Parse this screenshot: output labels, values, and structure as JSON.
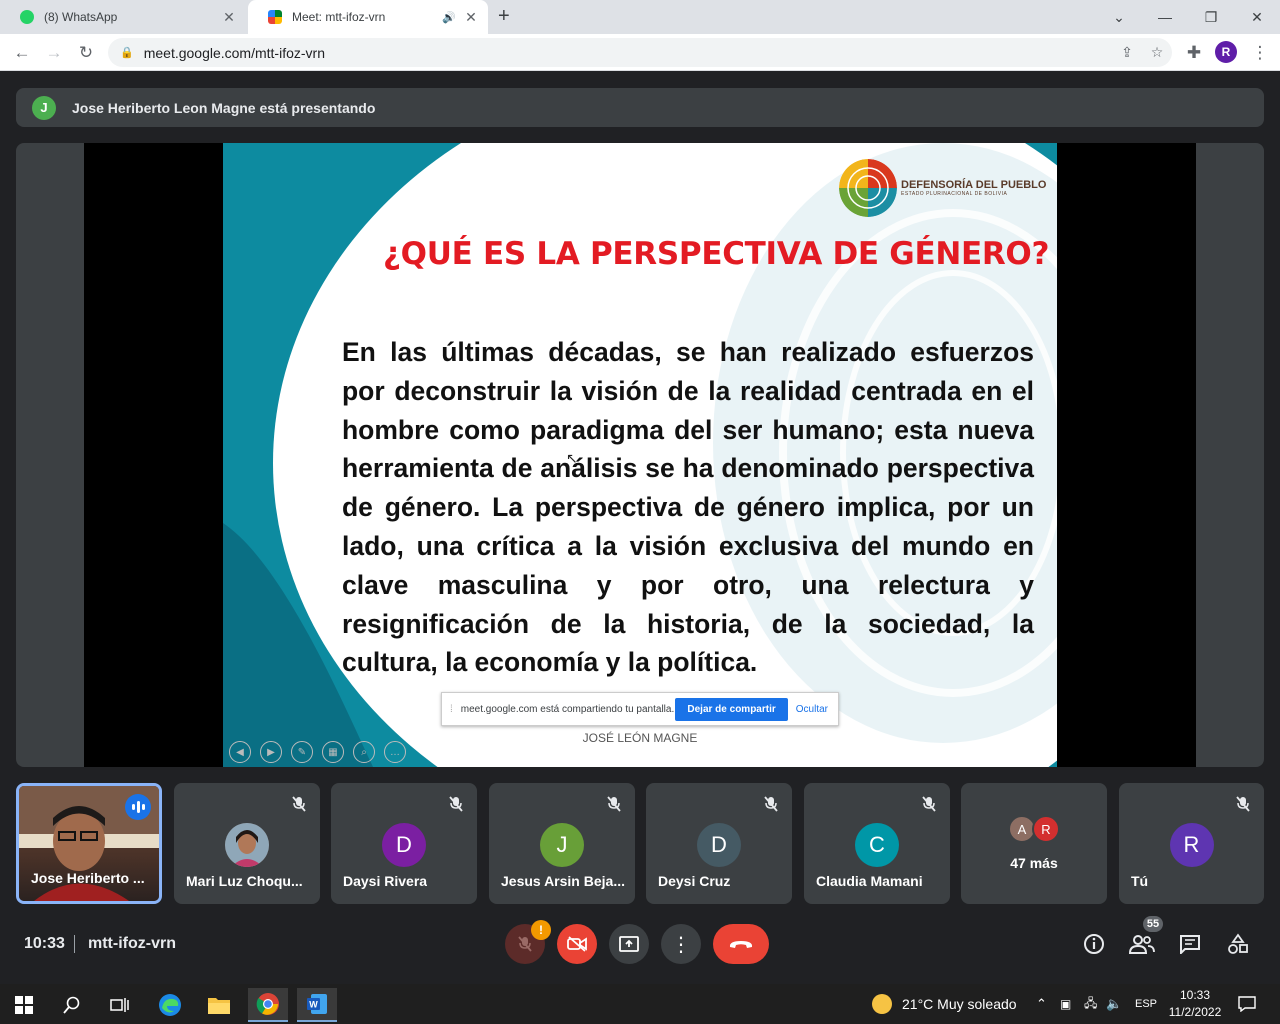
{
  "browser": {
    "tabs": [
      {
        "title": "(8) WhatsApp",
        "active": false
      },
      {
        "title": "Meet: mtt-ifoz-vrn",
        "active": true
      }
    ],
    "url": "meet.google.com/mtt-ifoz-vrn",
    "profile_initial": "R"
  },
  "meet": {
    "presenter_initial": "J",
    "presenting_text": "Jose Heriberto Leon Magne está presentando",
    "slide": {
      "logo_name": "DEFENSORÍA DEL PUEBLO",
      "logo_sub": "ESTADO PLURINACIONAL DE BOLIVIA",
      "title": "¿QUÉ ES LA PERSPECTIVA DE GÉNERO?",
      "body": "En las últimas décadas, se han realizado esfuerzos por deconstruir la visión de la realidad centrada en el hombre como paradigma del ser humano; esta nueva herramienta de análisis se ha denominado perspectiva de género. La perspectiva de género implica, por un lado, una crítica a la visión exclusiva del mundo en clave masculina y por otro, una relectura y resignificación de la historia, de la sociedad, la cultura, la economía y la política.",
      "author": "JOSÉ LEÓN MAGNE",
      "share_message": "meet.google.com está compartiendo tu pantalla.",
      "stop_sharing": "Dejar de compartir",
      "hide": "Ocultar"
    },
    "participants": [
      {
        "name": "Jose Heriberto ...",
        "type": "video",
        "speaking": true
      },
      {
        "name": "Mari Luz Choqu...",
        "type": "photo",
        "muted": true
      },
      {
        "name": "Daysi Rivera",
        "initial": "D",
        "color": "#7b1fa2",
        "muted": true
      },
      {
        "name": "Jesus Arsin Beja...",
        "initial": "J",
        "color": "#689f38",
        "muted": true
      },
      {
        "name": "Deysi Cruz",
        "initial": "D",
        "color": "#455a64",
        "muted": true
      },
      {
        "name": "Claudia Mamani",
        "initial": "C",
        "color": "#0097a7",
        "muted": true
      },
      {
        "name": "47 más",
        "type": "more",
        "avatars": [
          {
            "initial": "A",
            "color": "#8d6e63"
          },
          {
            "initial": "R",
            "color": "#d32f2f"
          }
        ]
      },
      {
        "name": "Tú",
        "initial": "R",
        "color": "#5e35b1",
        "muted": true
      }
    ],
    "time": "10:33",
    "meeting_code": "mtt-ifoz-vrn",
    "mic_alert": "!",
    "people_count": "55"
  },
  "taskbar": {
    "weather": "21°C  Muy soleado",
    "lang": "ESP",
    "time": "10:33",
    "date": "11/2/2022"
  }
}
